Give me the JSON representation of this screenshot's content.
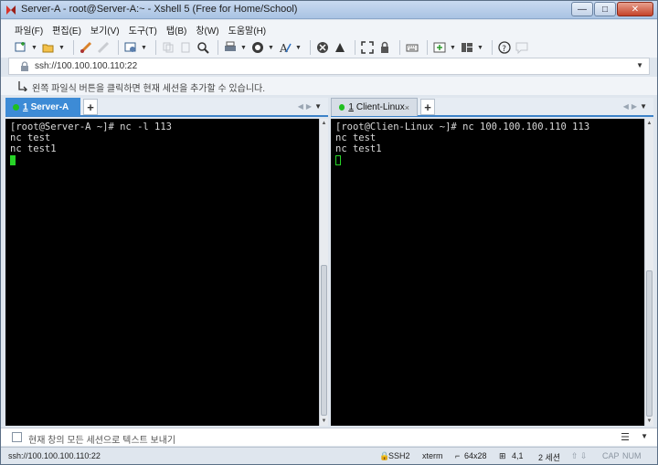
{
  "window": {
    "title": "Server-A - root@Server-A:~ - Xshell 5 (Free for Home/School)"
  },
  "menu": [
    "파일(F)",
    "편집(E)",
    "보기(V)",
    "도구(T)",
    "탭(B)",
    "창(W)",
    "도움말(H)"
  ],
  "address": {
    "value": "ssh://100.100.100.110:22"
  },
  "hint": {
    "text": "왼쪽 파일식 버튼을 클릭하면 현재 세션을 추가할 수 있습니다."
  },
  "left_pane": {
    "tab": {
      "number": "1",
      "label": "Server-A"
    },
    "lines": [
      "[root@Server-A ~]# nc -l 113",
      "nc test",
      "nc test1"
    ]
  },
  "right_pane": {
    "tab": {
      "number": "1",
      "label": "Client-Linux",
      "close": "×"
    },
    "lines": [
      "[root@Clien-Linux ~]# nc 100.100.100.110 113",
      "nc test",
      "nc test1"
    ]
  },
  "compose": {
    "placeholder": "현재 창의 모든 세션으로 텍스트 보내기"
  },
  "status": {
    "connection": "ssh://100.100.100.110:22",
    "protocol": "SSH2",
    "terminal": "xterm",
    "size": "64x28",
    "position": "4,1",
    "sessions": "2 세션",
    "caps": "CAP",
    "num": "NUM"
  },
  "colors": {
    "accent": "#3d8bd6",
    "cursor": "#27d327",
    "terminal_bg": "#000000"
  }
}
